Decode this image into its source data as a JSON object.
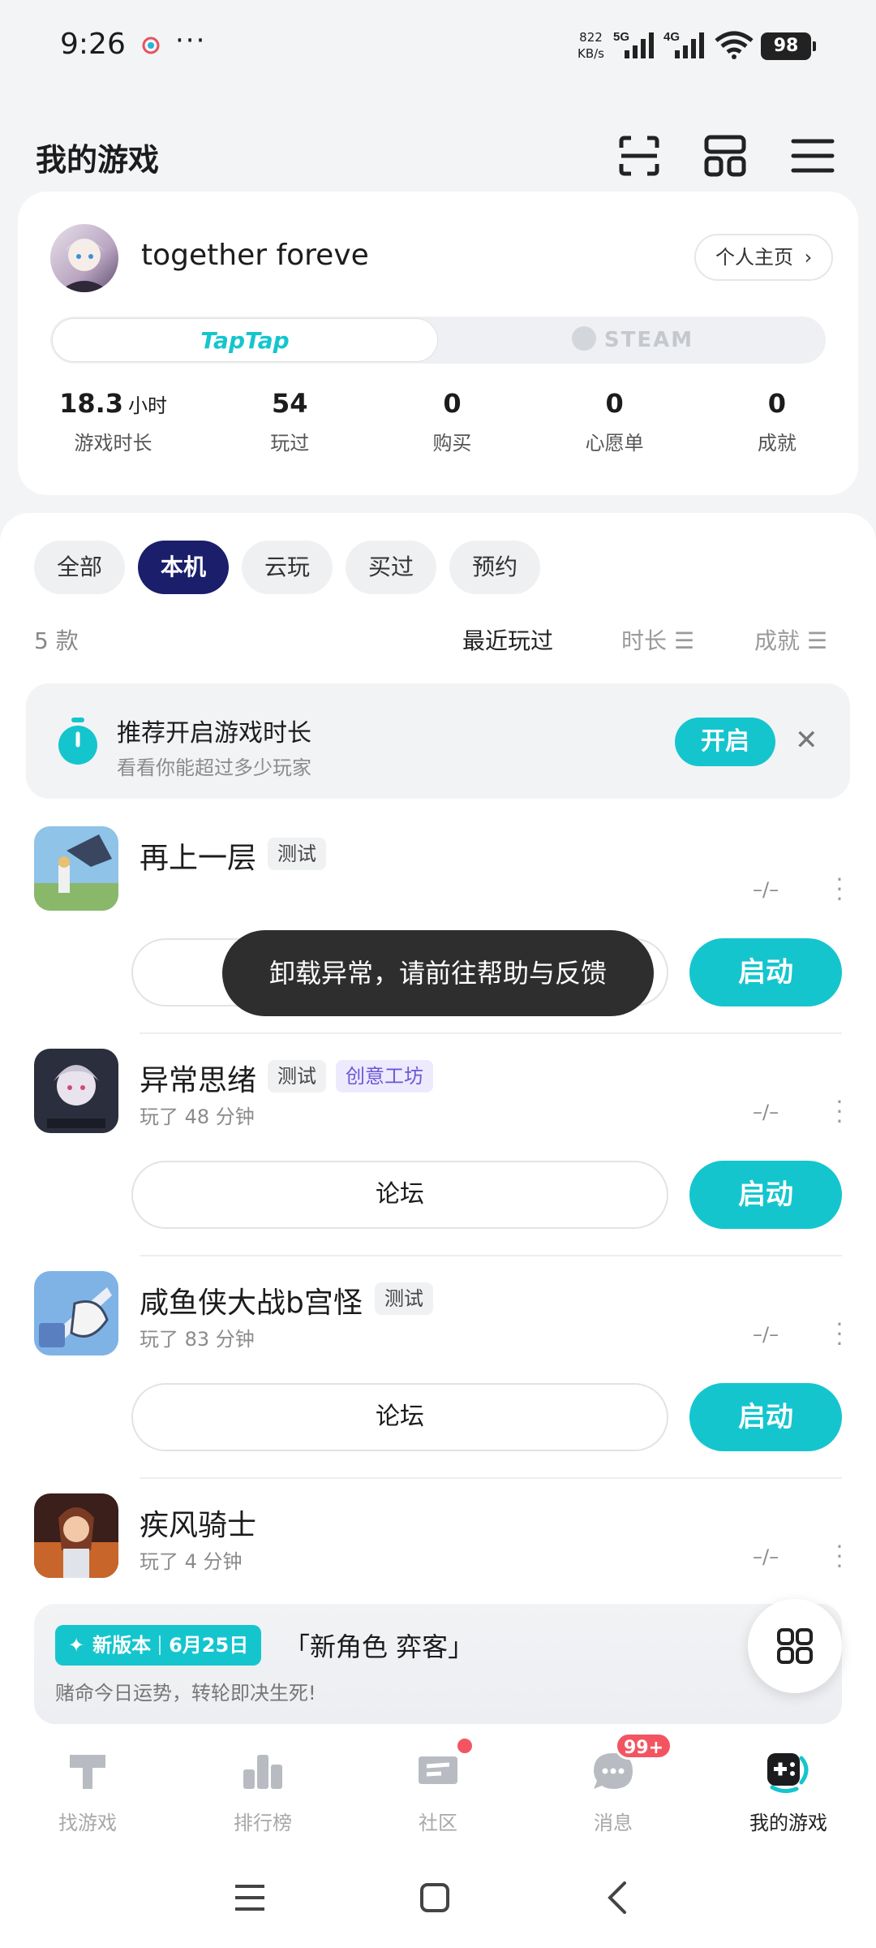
{
  "status_bar": {
    "time": "9:26",
    "dots": "···",
    "speed_value": "822",
    "speed_unit": "KB/s",
    "net1": "5G",
    "net2": "4G",
    "wifi_sub": "6",
    "battery": "98"
  },
  "header": {
    "title": "我的游戏",
    "icons": [
      "scan-icon",
      "layout-grid-icon",
      "menu-icon"
    ]
  },
  "profile": {
    "username": "together foreve",
    "homepage_label": "个人主页",
    "platform_tabs": [
      {
        "label": "TapTap",
        "active": true
      },
      {
        "label": "STEAM",
        "active": false
      }
    ],
    "stats": [
      {
        "value": "18.3",
        "unit": "小时",
        "label": "游戏时长"
      },
      {
        "value": "54",
        "unit": "",
        "label": "玩过"
      },
      {
        "value": "0",
        "unit": "",
        "label": "购买"
      },
      {
        "value": "0",
        "unit": "",
        "label": "心愿单"
      },
      {
        "value": "0",
        "unit": "",
        "label": "成就"
      }
    ]
  },
  "filters": {
    "chips": [
      {
        "label": "全部",
        "active": false
      },
      {
        "label": "本机",
        "active": true
      },
      {
        "label": "云玩",
        "active": false
      },
      {
        "label": "买过",
        "active": false
      },
      {
        "label": "预约",
        "active": false
      }
    ],
    "count": "5 款",
    "sorts": [
      {
        "label": "最近玩过",
        "active": true
      },
      {
        "label": "时长",
        "active": false
      },
      {
        "label": "成就",
        "active": false
      }
    ]
  },
  "recommend": {
    "title": "推荐开启游戏时长",
    "subtitle": "看看你能超过多少玩家",
    "enable_label": "开启",
    "close": "✕"
  },
  "games": [
    {
      "name": "再上一层",
      "tags": [
        "测试"
      ],
      "workshop": "",
      "played": "",
      "rating": "–/–",
      "forum": "论坛",
      "launch": "启动"
    },
    {
      "name": "异常思绪",
      "tags": [
        "测试"
      ],
      "workshop": "创意工坊",
      "played": "玩了 48 分钟",
      "rating": "–/–",
      "forum": "论坛",
      "launch": "启动"
    },
    {
      "name": "咸鱼侠大战b宫怪",
      "tags": [
        "测试"
      ],
      "workshop": "",
      "played": "玩了 83 分钟",
      "rating": "–/–",
      "forum": "论坛",
      "launch": "启动"
    },
    {
      "name": "疾风骑士",
      "tags": [],
      "workshop": "",
      "played": "玩了 4 分钟",
      "rating": "–/–"
    }
  ],
  "toast": "卸载异常，请前往帮助与反馈",
  "banner": {
    "badge_new": "新版本",
    "badge_date": "6月25日",
    "title": "「新角色 弈客」",
    "subtitle": "赌命今日运势，转轮即决生死!"
  },
  "bottom_nav": [
    {
      "label": "找游戏",
      "active": false
    },
    {
      "label": "排行榜",
      "active": false
    },
    {
      "label": "社区",
      "active": false
    },
    {
      "label": "消息",
      "active": false,
      "badge": "99+"
    },
    {
      "label": "我的游戏",
      "active": true
    }
  ],
  "colors": {
    "accent": "#15c5ce",
    "chip_active": "#1a1e6b",
    "badge_red": "#f25561"
  }
}
